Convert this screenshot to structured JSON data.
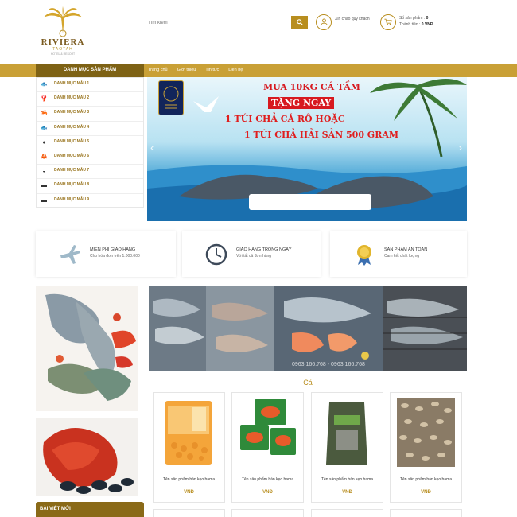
{
  "header": {
    "logo": {
      "name": "RIVIERA",
      "sub": "TAOTAH",
      "tagline": "HOTEL & RESORT"
    },
    "search": {
      "placeholder": "Tìm kiếm",
      "button_icon": "search-icon"
    },
    "account": {
      "icon": "user-icon",
      "text": "Xin chào quý khách"
    },
    "cart": {
      "icon": "cart-icon",
      "count_label": "Số sản phẩm :",
      "count_value": "0",
      "total_label": "Thành tiền :",
      "total_value": "0 VNĐ"
    }
  },
  "nav": {
    "category_label": "DANH MỤC SẢN PHẨM",
    "links": [
      "Trang chủ",
      "Giới thiệu",
      "Tin tức",
      "Liên hệ"
    ]
  },
  "sidebar": {
    "items": [
      {
        "label": "DANH MỤC MẪU 1",
        "icon": "fish-icon"
      },
      {
        "label": "DANH MỤC MẪU 2",
        "icon": "lobster-icon"
      },
      {
        "label": "DANH MỤC MẪU 3",
        "icon": "shrimp-icon"
      },
      {
        "label": "DANH MỤC MẪU 4",
        "icon": "fish-icon"
      },
      {
        "label": "DANH MỤC MẪU 5",
        "icon": "shell-icon"
      },
      {
        "label": "DANH MỤC MẪU 6",
        "icon": "crab-icon"
      },
      {
        "label": "DANH MỤC MẪU 7",
        "icon": "clam-icon"
      },
      {
        "label": "DANH MỤC MẪU 8",
        "icon": "tin-icon"
      },
      {
        "label": "DANH MỤC MẪU 9",
        "icon": "can-icon"
      }
    ]
  },
  "banner": {
    "line1": "MUA 10KG CÁ TẦM",
    "line2": "TẶNG NGAY",
    "line3": "1 TÚI CHẢ CÁ RÔ HOẶC",
    "line4": "1 TÚI CHẢ HẢI SẢN 500 GRAM",
    "prev_icon": "chevron-left-icon",
    "next_icon": "chevron-right-icon"
  },
  "features": [
    {
      "title": "MIỄN PHÍ GIAO HÀNG",
      "desc": "Cho hóa đơn trên 1.000.000",
      "icon": "airplane-icon"
    },
    {
      "title": "GIAO HÀNG TRONG NGÀY",
      "desc": "Với tất cả đơn hàng",
      "icon": "clock-icon"
    },
    {
      "title": "SẢN PHẨM AN TOÀN",
      "desc": "Cam kết chất lượng",
      "icon": "medal-icon"
    }
  ],
  "wide_image": {
    "watermark": "0963.166.768 - 0963.166.768"
  },
  "section": {
    "title": "Cá"
  },
  "products": [
    {
      "name": "Tên sản phẩm bán kẹo hama",
      "price": "VNĐ"
    },
    {
      "name": "Tên sản phẩm bán kẹo hama",
      "price": "VNĐ"
    },
    {
      "name": "Tên sản phẩm bán kẹo hama",
      "price": "VNĐ"
    },
    {
      "name": "Tên sản phẩm bán kẹo hama",
      "price": "VNĐ"
    }
  ],
  "news": {
    "title": "BÀI VIẾT MỚI"
  },
  "colors": {
    "gold": "#c9a036",
    "dark_gold": "#7e6215",
    "accent": "#b88e1f",
    "promo_red": "#d7191f"
  }
}
